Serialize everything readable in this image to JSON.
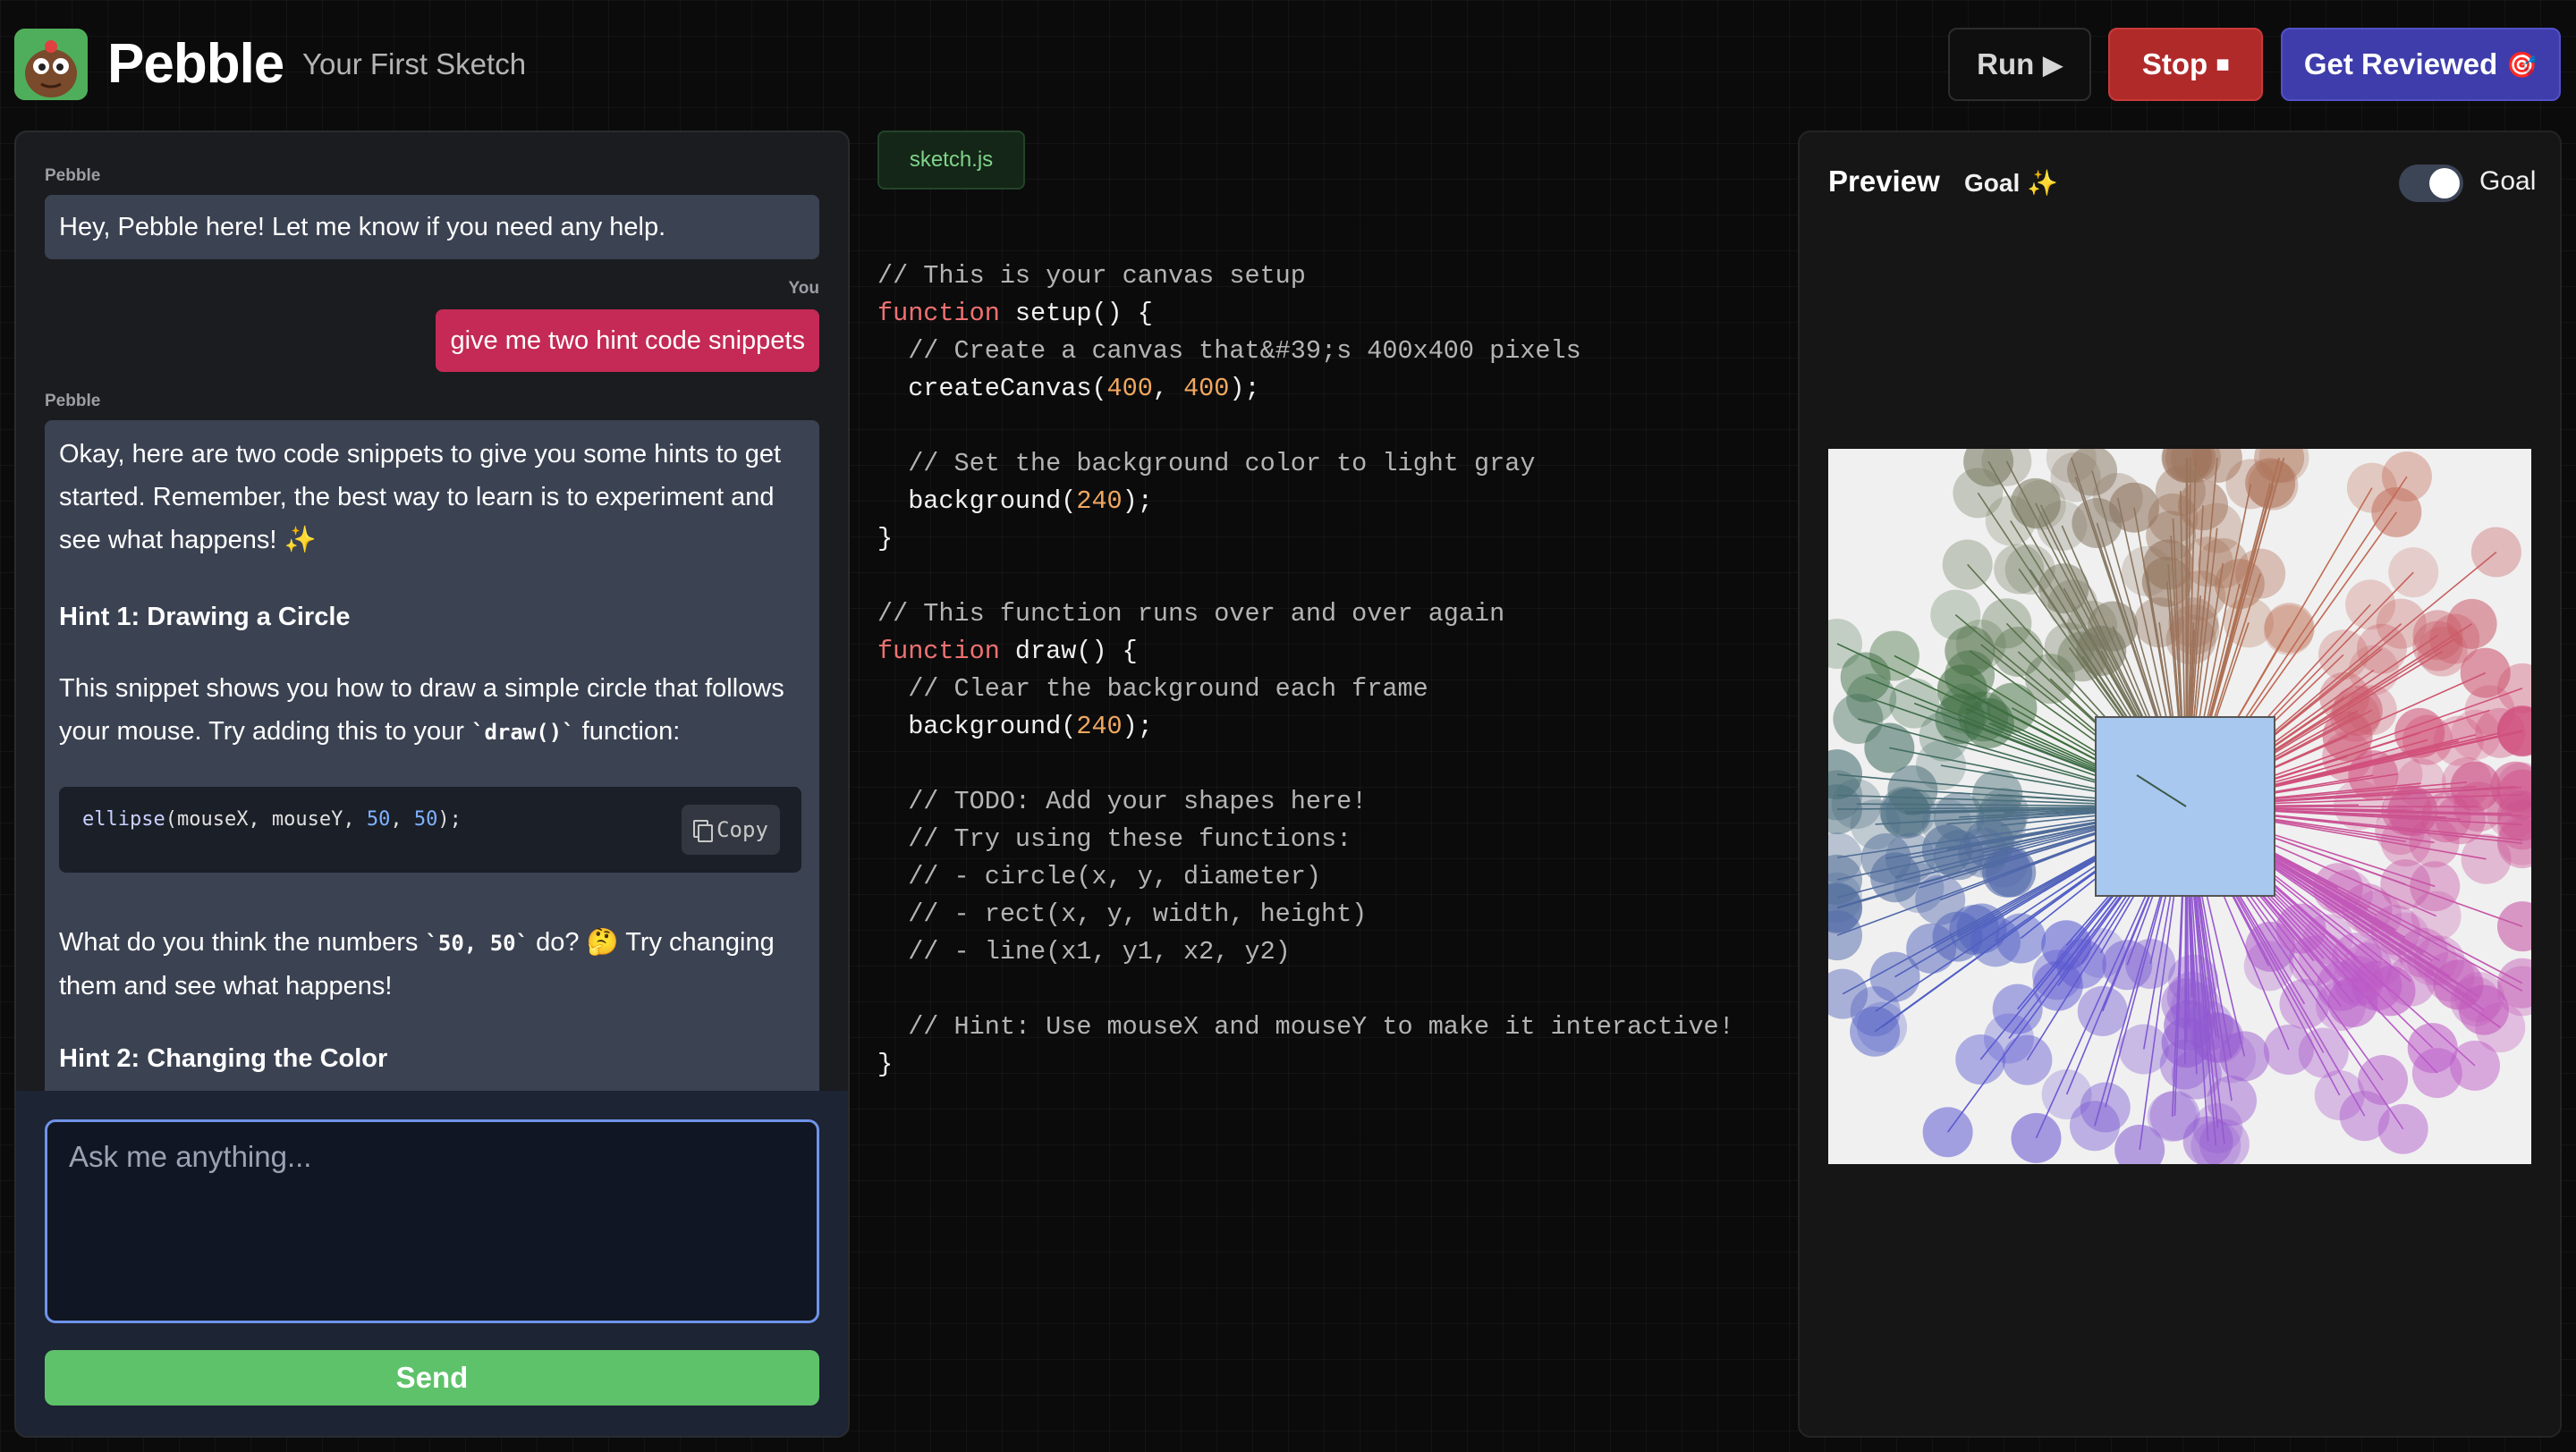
{
  "header": {
    "title": "Pebble",
    "subtitle": "Your First Sketch",
    "run_label": "Run",
    "run_icon": "▶",
    "stop_label": "Stop",
    "stop_icon": "⏹",
    "review_label": "Get Reviewed",
    "review_icon": "🎯"
  },
  "chat": {
    "messages": [
      {
        "sender": "Pebble",
        "text": "Hey, Pebble here! Let me know if you need any help."
      },
      {
        "sender": "You",
        "text": "give me two hint code snippets"
      },
      {
        "sender": "Pebble",
        "intro": "Okay, here are two code snippets to give you some hints to get started. Remember, the best way to learn is to experiment and see what happens! ✨",
        "hint1_title": "Hint 1: Drawing a Circle",
        "hint1_text_a": "This snippet shows you how to draw a simple circle that follows your mouse. Try adding this to your ",
        "hint1_code_inline": "`draw()`",
        "hint1_text_b": " function:",
        "code_fn": "ellipse",
        "code_args_a": "(mouseX, mouseY, ",
        "code_num1": "50",
        "code_sep": ", ",
        "code_num2": "50",
        "code_end": ");",
        "copy_label": "Copy",
        "question_a": "What do you think the numbers ",
        "question_code": "`50, 50`",
        "question_b": " do? 🤔 Try changing them and see what happens!",
        "hint2_title": "Hint 2: Changing the Color"
      }
    ],
    "input_placeholder": "Ask me anything...",
    "send_label": "Send"
  },
  "editor": {
    "filename": "sketch.js",
    "lines": [
      [
        [
          "comment",
          "// This is your canvas setup"
        ]
      ],
      [
        [
          "kw",
          "function"
        ],
        [
          "plain",
          " setup() {"
        ]
      ],
      [
        [
          "comment",
          "  // Create a canvas that&#39;s 400x400 pixels"
        ]
      ],
      [
        [
          "plain",
          "  createCanvas("
        ],
        [
          "num",
          "400"
        ],
        [
          "plain",
          ", "
        ],
        [
          "num",
          "400"
        ],
        [
          "plain",
          ");"
        ]
      ],
      [],
      [
        [
          "comment",
          "  // Set the background color to light gray"
        ]
      ],
      [
        [
          "plain",
          "  background("
        ],
        [
          "num",
          "240"
        ],
        [
          "plain",
          ");"
        ]
      ],
      [
        [
          "plain",
          "}"
        ]
      ],
      [],
      [
        [
          "comment",
          "// This function runs over and over again"
        ]
      ],
      [
        [
          "kw",
          "function"
        ],
        [
          "plain",
          " draw() {"
        ]
      ],
      [
        [
          "comment",
          "  // Clear the background each frame"
        ]
      ],
      [
        [
          "plain",
          "  background("
        ],
        [
          "num",
          "240"
        ],
        [
          "plain",
          ");"
        ]
      ],
      [],
      [
        [
          "comment",
          "  // TODO: Add your shapes here!"
        ]
      ],
      [
        [
          "comment",
          "  // Try using these functions:"
        ]
      ],
      [
        [
          "comment",
          "  // - circle(x, y, diameter)"
        ]
      ],
      [
        [
          "comment",
          "  // - rect(x, y, width, height)"
        ]
      ],
      [
        [
          "comment",
          "  // - line(x1, y1, x2, y2)"
        ]
      ],
      [],
      [
        [
          "comment",
          "  // Hint: Use mouseX and mouseY to make it interactive!"
        ]
      ],
      [
        [
          "plain",
          "}"
        ]
      ]
    ],
    "colors": {
      "comment": "#b4b4b4",
      "kw": "#f07171",
      "num": "#f0a860",
      "plain": "#f0f0f0"
    }
  },
  "preview": {
    "title": "Preview",
    "goal_label": "Goal ✨",
    "toggle_label": "Goal",
    "toggle_on": true
  }
}
